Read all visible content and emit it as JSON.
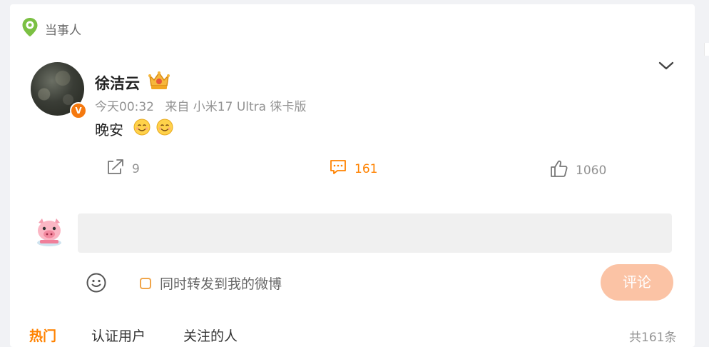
{
  "tag": {
    "label": "当事人",
    "icon": "location-pin-icon",
    "color": "#7bc043"
  },
  "post": {
    "username": "徐洁云",
    "time": "今天00:32",
    "source": "来自 小米17 Ultra 徕卡版",
    "text": "晚安",
    "emojis": [
      "smile-emoji",
      "smile-emoji"
    ],
    "verified_badge": "V"
  },
  "actions": {
    "share_count": "9",
    "comment_count": "161",
    "like_count": "1060"
  },
  "composer": {
    "placeholder": "",
    "forward_label": "同时转发到我的微博",
    "submit_label": "评论"
  },
  "tabs": [
    "热门",
    "认证用户",
    "关注的人"
  ],
  "total": "共161条",
  "colors": {
    "accent": "#ff8200",
    "verified": "#f5790f",
    "submit_disabled": "#fbc3a5"
  }
}
